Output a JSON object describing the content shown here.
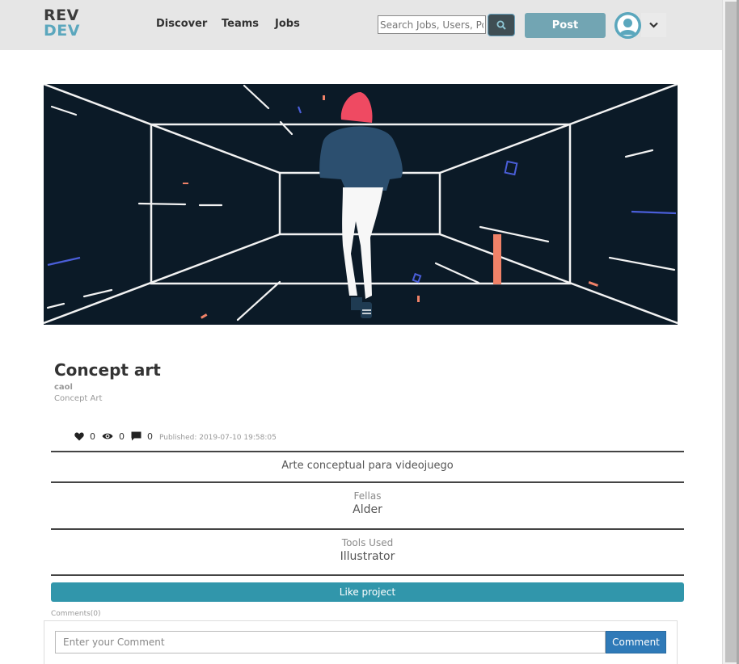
{
  "brand": {
    "line1": "REV",
    "line2": "DEV"
  },
  "nav": {
    "links": [
      "Discover",
      "Teams",
      "Jobs"
    ]
  },
  "search": {
    "placeholder": "Search Jobs, Users, Po"
  },
  "header": {
    "post_label": "Post"
  },
  "project": {
    "title": "Concept art",
    "author": "caol",
    "category": "Concept Art",
    "likes": "0",
    "views": "0",
    "comments_count": "0",
    "published": "Published: 2019-07-10 19:58:05",
    "description": "Arte conceptual para videojuego",
    "fellas_label": "Fellas",
    "fellas_value": "Alder",
    "tools_label": "Tools Used",
    "tools_value": "Illustrator",
    "like_label": "Like project"
  },
  "comments": {
    "label": "Comments(0)",
    "placeholder": "Enter your Comment",
    "button_label": "Comment"
  },
  "colors": {
    "accent": "#3196ab",
    "post_button": "#72a5b3",
    "brand_dev": "#5ba7bd",
    "comment_button": "#2f7ab8",
    "banner_bg": "#0b1a27"
  }
}
